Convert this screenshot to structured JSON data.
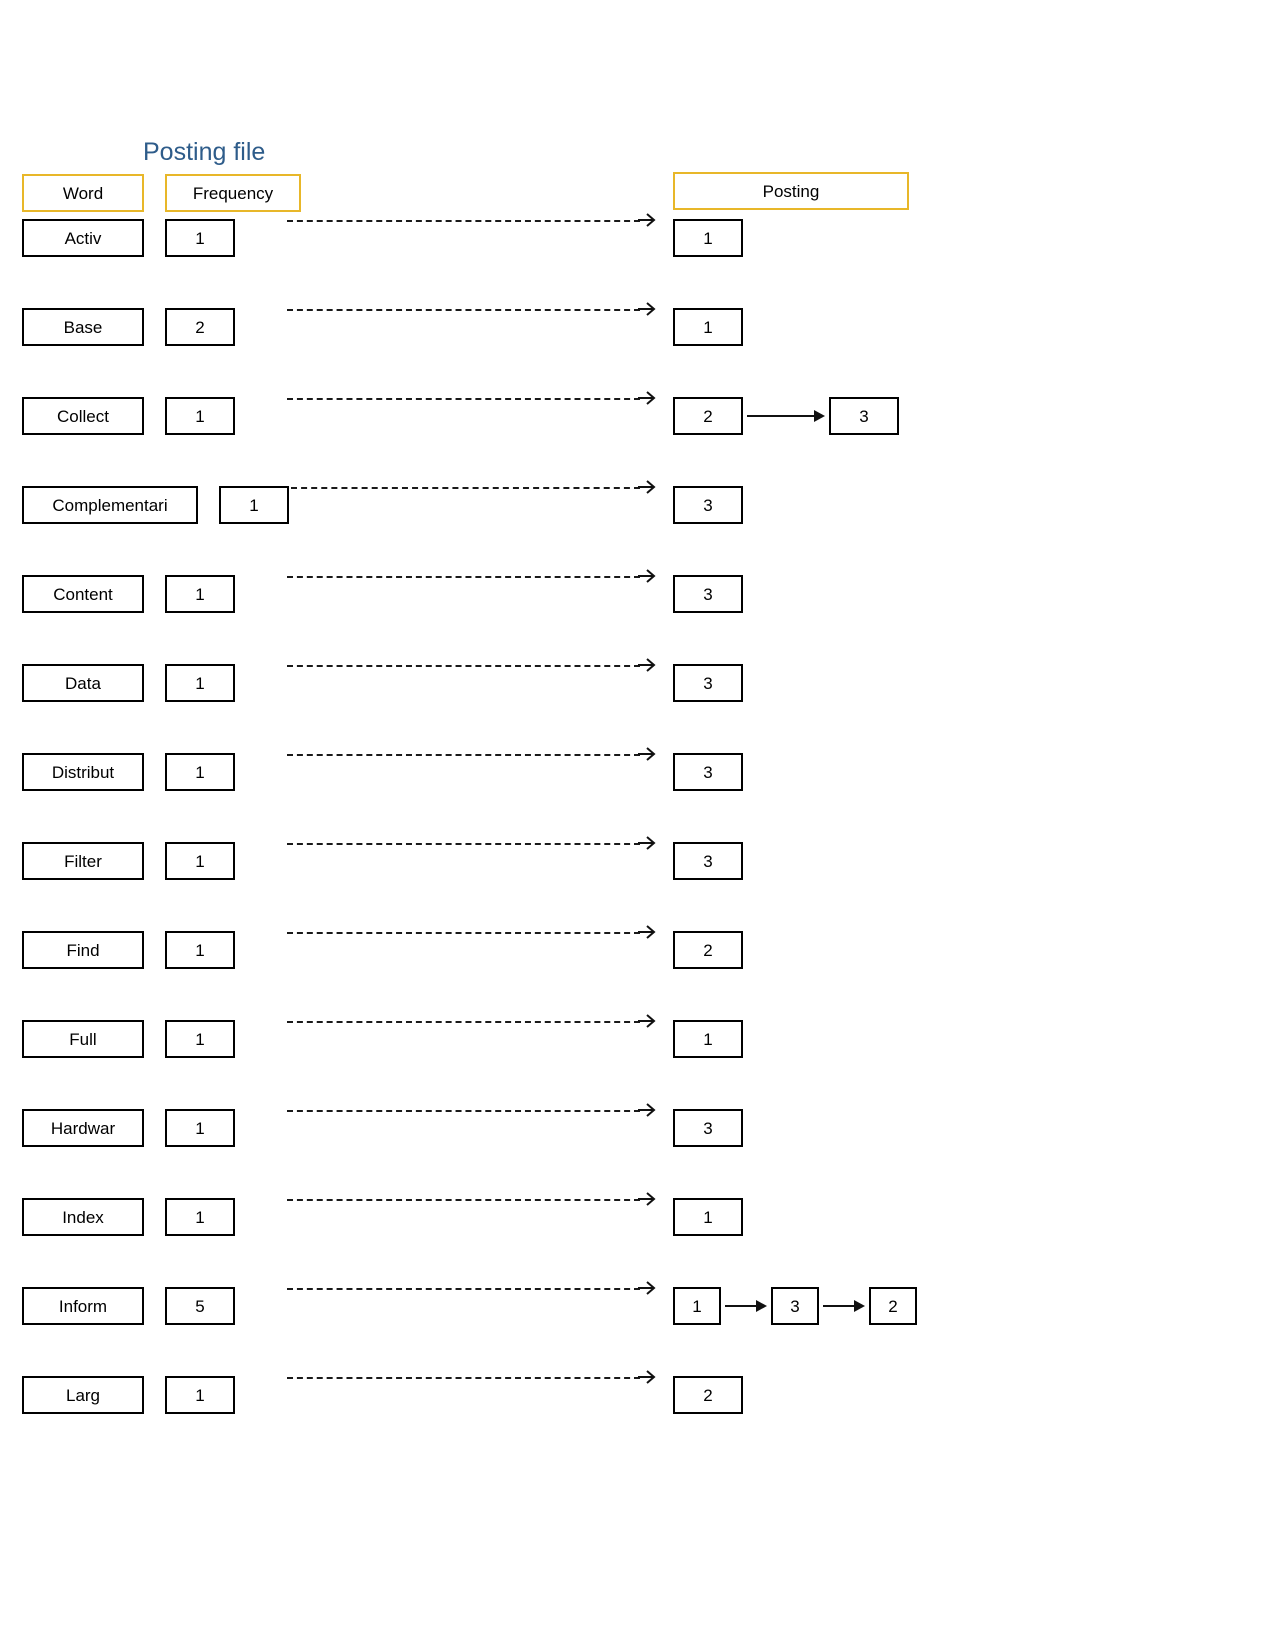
{
  "title": "Posting file",
  "colors": {
    "title": "#2E5C8A",
    "header_border": "#E8B729",
    "box_border": "#000000",
    "connector": "#1a1a1a"
  },
  "headers": {
    "word": "Word",
    "frequency": "Frequency",
    "posting": "Posting"
  },
  "chart_data": {
    "type": "table",
    "title": "Posting file",
    "columns": [
      "Word",
      "Frequency",
      "Posting"
    ],
    "rows": [
      {
        "word": "Activ",
        "frequency": "1",
        "postings": [
          "1"
        ]
      },
      {
        "word": "Base",
        "frequency": "2",
        "postings": [
          "1"
        ]
      },
      {
        "word": "Collect",
        "frequency": "1",
        "postings": [
          "2",
          "3"
        ]
      },
      {
        "word": "Complementari",
        "frequency": "1",
        "postings": [
          "3"
        ]
      },
      {
        "word": "Content",
        "frequency": "1",
        "postings": [
          "3"
        ]
      },
      {
        "word": "Data",
        "frequency": "1",
        "postings": [
          "3"
        ]
      },
      {
        "word": "Distribut",
        "frequency": "1",
        "postings": [
          "3"
        ]
      },
      {
        "word": "Filter",
        "frequency": "1",
        "postings": [
          "3"
        ]
      },
      {
        "word": "Find",
        "frequency": "1",
        "postings": [
          "2"
        ]
      },
      {
        "word": "Full",
        "frequency": "1",
        "postings": [
          "1"
        ]
      },
      {
        "word": "Hardwar",
        "frequency": "1",
        "postings": [
          "3"
        ]
      },
      {
        "word": "Index",
        "frequency": "1",
        "postings": [
          "1"
        ]
      },
      {
        "word": "Inform",
        "frequency": "5",
        "postings": [
          "1",
          "3",
          "2"
        ]
      },
      {
        "word": "Larg",
        "frequency": "1",
        "postings": [
          "2"
        ]
      }
    ]
  },
  "rows": [
    {
      "word": "Activ",
      "frequency": "1",
      "postings": [
        "1"
      ]
    },
    {
      "word": "Base",
      "frequency": "2",
      "postings": [
        "1"
      ]
    },
    {
      "word": "Collect",
      "frequency": "1",
      "postings": [
        "2",
        "3"
      ]
    },
    {
      "word": "Complementari",
      "frequency": "1",
      "postings": [
        "3"
      ]
    },
    {
      "word": "Content",
      "frequency": "1",
      "postings": [
        "3"
      ]
    },
    {
      "word": "Data",
      "frequency": "1",
      "postings": [
        "3"
      ]
    },
    {
      "word": "Distribut",
      "frequency": "1",
      "postings": [
        "3"
      ]
    },
    {
      "word": "Filter",
      "frequency": "1",
      "postings": [
        "3"
      ]
    },
    {
      "word": "Find",
      "frequency": "1",
      "postings": [
        "2"
      ]
    },
    {
      "word": "Full",
      "frequency": "1",
      "postings": [
        "1"
      ]
    },
    {
      "word": "Hardwar",
      "frequency": "1",
      "postings": [
        "3"
      ]
    },
    {
      "word": "Index",
      "frequency": "1",
      "postings": [
        "1"
      ]
    },
    {
      "word": "Inform",
      "frequency": "5",
      "postings": [
        "1",
        "3",
        "2"
      ]
    },
    {
      "word": "Larg",
      "frequency": "1",
      "postings": [
        "2"
      ]
    }
  ],
  "icons": {
    "dashed_arrow": "dashed-arrow-icon",
    "chain_arrow": "chain-arrow-icon"
  }
}
